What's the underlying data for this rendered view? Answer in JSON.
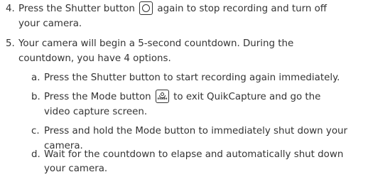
{
  "items": [
    {
      "num": "4.",
      "line1_pre": "Press the Shutter button",
      "icon": "shutter-button-icon",
      "line1_post": "again to stop recording and turn off",
      "line2": "your camera."
    },
    {
      "num": "5.",
      "line1": "Your camera will begin a 5-second countdown. During the",
      "line2": "countdown, you have 4 options."
    }
  ],
  "subitems": [
    {
      "letter": "a.",
      "line1": "Press the Shutter button to start recording again immediately."
    },
    {
      "letter": "b.",
      "line1_pre": "Press the Mode button",
      "icon": "mode-button-icon",
      "icon_text": "mode",
      "line1_post": "to exit QuikCapture and go the",
      "line2": "video capture screen."
    },
    {
      "letter": "c.",
      "line1": "Press and hold the Mode button to immediately shut down your",
      "line2": "camera."
    },
    {
      "letter": "d.",
      "line1": "Wait for the countdown to elapse and automatically shut down",
      "line2": "your camera."
    }
  ]
}
